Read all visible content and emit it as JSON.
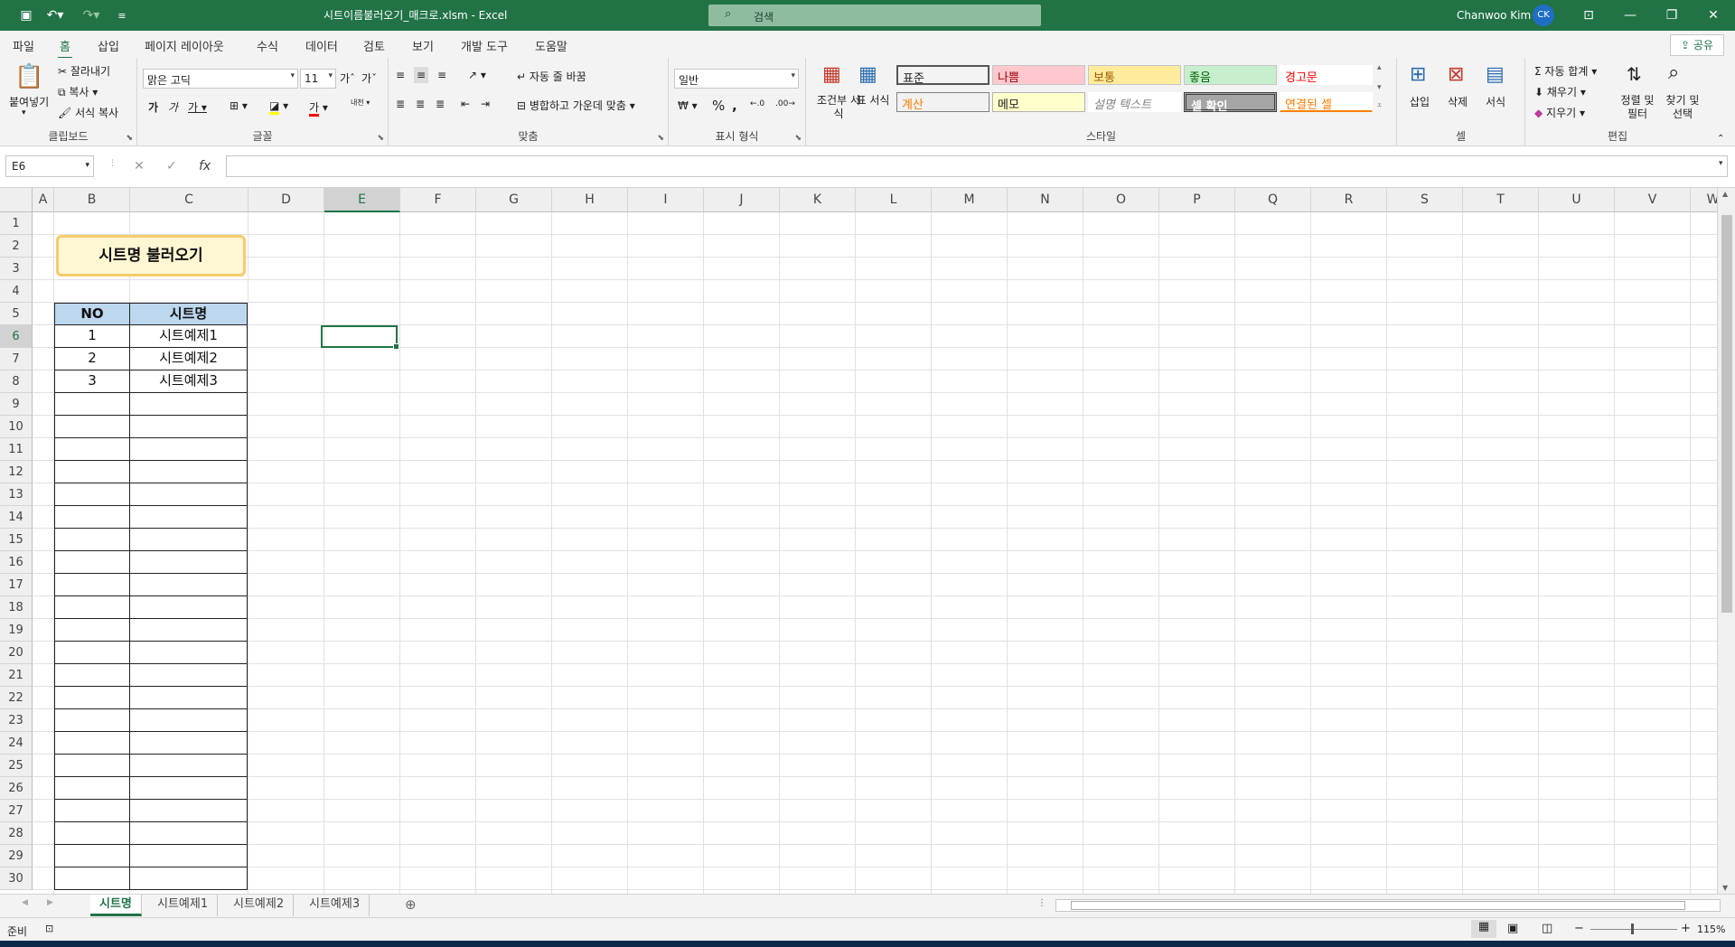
{
  "window": {
    "title": "시트이름불러오기_매크로.xlsm  -  Excel",
    "search_placeholder": "검색",
    "user": "Chanwoo Kim",
    "avatar": "CK"
  },
  "menu": {
    "items": [
      "파일",
      "홈",
      "삽입",
      "페이지 레이아웃",
      "수식",
      "데이터",
      "검토",
      "보기",
      "개발 도구",
      "도움말"
    ],
    "active": "홈",
    "share": "공유"
  },
  "ribbon": {
    "clipboard": {
      "label": "클립보드",
      "paste": "붙여넣기",
      "cut": "잘라내기",
      "copy": "복사",
      "format_painter": "서식 복사"
    },
    "font": {
      "label": "글꼴",
      "name": "맑은 고딕",
      "size": "11"
    },
    "alignment": {
      "label": "맞춤",
      "wrap": "자동 줄 바꿈",
      "merge": "병합하고 가운데 맞춤"
    },
    "number": {
      "label": "표시 형식",
      "format": "일반"
    },
    "styles": {
      "label": "스타일",
      "conditional": "조건부 서식",
      "table": "표 서식",
      "cells": [
        {
          "text": "표준",
          "bg": "#ffffff",
          "fg": "#000000"
        },
        {
          "text": "나쁨",
          "bg": "#ffc7ce",
          "fg": "#9c0006"
        },
        {
          "text": "보통",
          "bg": "#ffeb9c",
          "fg": "#9c5700"
        },
        {
          "text": "좋음",
          "bg": "#c6efce",
          "fg": "#006100"
        },
        {
          "text": "경고문",
          "bg": "#ffffff",
          "fg": "#ff0000"
        },
        {
          "text": "계산",
          "bg": "#f2f2f2",
          "fg": "#fa7d00"
        },
        {
          "text": "메모",
          "bg": "#ffffcc",
          "fg": "#000000"
        },
        {
          "text": "설명 텍스트",
          "bg": "#ffffff",
          "fg": "#7f7f7f"
        },
        {
          "text": "셀 확인",
          "bg": "#a5a5a5",
          "fg": "#ffffff"
        },
        {
          "text": "연결된 셀",
          "bg": "#ffffff",
          "fg": "#fa7d00"
        }
      ]
    },
    "cells": {
      "label": "셀",
      "insert": "삽입",
      "delete": "삭제",
      "format": "서식"
    },
    "editing": {
      "label": "편집",
      "autosum": "자동 합계",
      "fill": "채우기",
      "clear": "지우기",
      "sort": "정렬 및 필터",
      "find": "찾기 및 선택"
    }
  },
  "formula_bar": {
    "name_box": "E6",
    "fx": "fx",
    "value": ""
  },
  "grid": {
    "columns": [
      "A",
      "B",
      "C",
      "D",
      "E",
      "F",
      "G",
      "H",
      "I",
      "J",
      "K",
      "L",
      "M",
      "N",
      "O",
      "P",
      "Q",
      "R",
      "S",
      "T",
      "U",
      "V",
      "W"
    ],
    "selected_column": "E",
    "rows": [
      "1",
      "2",
      "3",
      "4",
      "5",
      "6",
      "7",
      "8",
      "9",
      "10",
      "11",
      "12",
      "13",
      "14",
      "15",
      "16",
      "17",
      "18",
      "19",
      "20",
      "21",
      "22",
      "23",
      "24",
      "25",
      "26",
      "27",
      "28",
      "29",
      "30"
    ],
    "selected_row": "6",
    "title_box": "시트명 불러오기",
    "table_headers": [
      "NO",
      "시트명"
    ],
    "table_rows": [
      [
        "1",
        "시트예제1"
      ],
      [
        "2",
        "시트예제2"
      ],
      [
        "3",
        "시트예제3"
      ]
    ]
  },
  "sheets": {
    "tabs": [
      "시트명",
      "시트예제1",
      "시트예제2",
      "시트예제3"
    ],
    "active": "시트명"
  },
  "status": {
    "ready": "준비",
    "zoom": "115%"
  },
  "colors": {
    "accent": "#217346",
    "header_fill": "#bdd7ee",
    "title_fill": "#fff6d3",
    "title_border": "#f5cc6c"
  }
}
